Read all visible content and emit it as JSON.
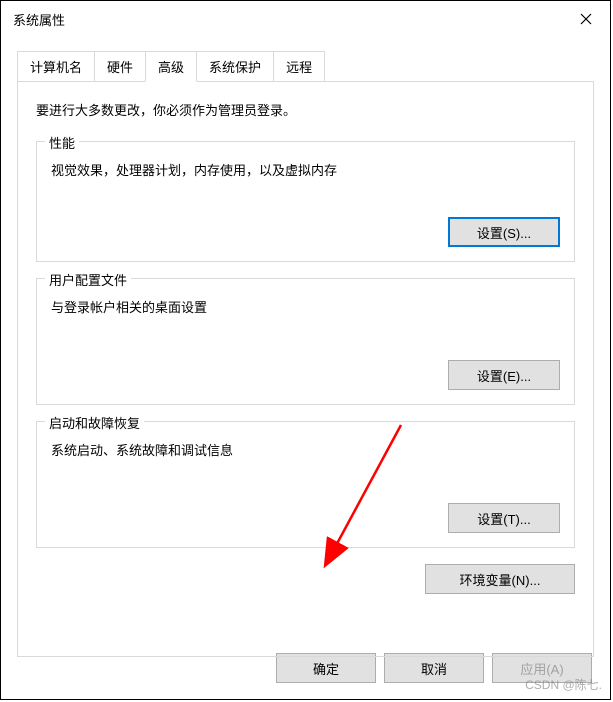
{
  "titlebar": {
    "title": "系统属性"
  },
  "tabs": {
    "items": [
      {
        "label": "计算机名"
      },
      {
        "label": "硬件"
      },
      {
        "label": "高级"
      },
      {
        "label": "系统保护"
      },
      {
        "label": "远程"
      }
    ],
    "active_index": 2
  },
  "panel": {
    "intro": "要进行大多数更改，你必须作为管理员登录。",
    "performance": {
      "title": "性能",
      "desc": "视觉效果，处理器计划，内存使用，以及虚拟内存",
      "button": "设置(S)..."
    },
    "userprofile": {
      "title": "用户配置文件",
      "desc": "与登录帐户相关的桌面设置",
      "button": "设置(E)..."
    },
    "startup": {
      "title": "启动和故障恢复",
      "desc": "系统启动、系统故障和调试信息",
      "button": "设置(T)..."
    },
    "env_button": "环境变量(N)..."
  },
  "buttons": {
    "ok": "确定",
    "cancel": "取消",
    "apply": "应用(A)"
  },
  "watermark": "CSDN @陈七."
}
